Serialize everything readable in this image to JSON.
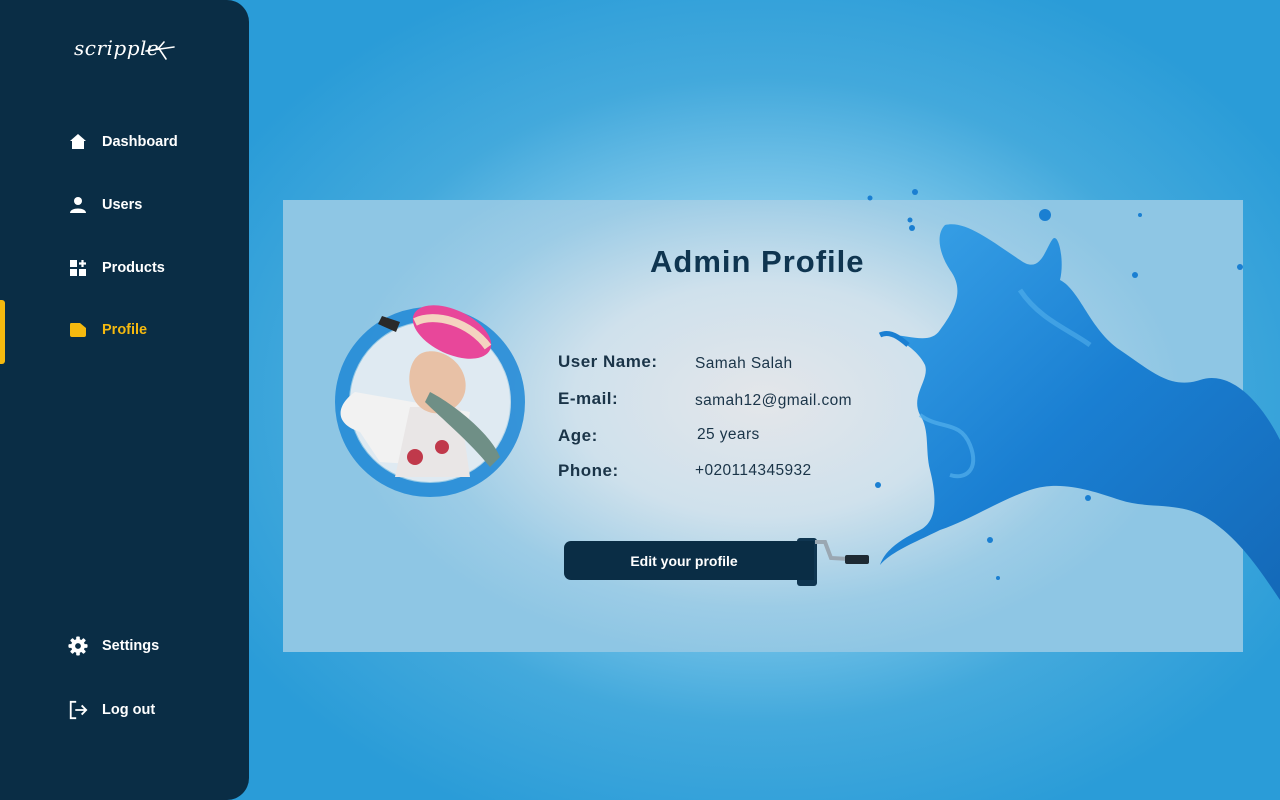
{
  "sidebar": {
    "logo_text": "scripple",
    "items": [
      {
        "label": "Dashboard",
        "icon": "home-icon"
      },
      {
        "label": "Users",
        "icon": "user-icon"
      },
      {
        "label": "Products",
        "icon": "grid-plus-icon"
      },
      {
        "label": "Profile",
        "icon": "folder-icon",
        "active": true
      }
    ],
    "bottom_items": [
      {
        "label": "Settings",
        "icon": "gear-icon"
      },
      {
        "label": "Log out",
        "icon": "logout-icon"
      }
    ]
  },
  "main": {
    "title": "Admin Profile",
    "fields": [
      {
        "label": "User Name:",
        "value": "Samah Salah"
      },
      {
        "label": "E-mail:",
        "value": "samah12@gmail.com"
      },
      {
        "label": "Age:",
        "value": "25 years"
      },
      {
        "label": "Phone:",
        "value": "+020114345932"
      }
    ],
    "edit_button": "Edit your profile"
  },
  "colors": {
    "sidebar_bg": "#0a2d45",
    "accent": "#f5b90f",
    "paint_blue": "#1d87d6"
  }
}
